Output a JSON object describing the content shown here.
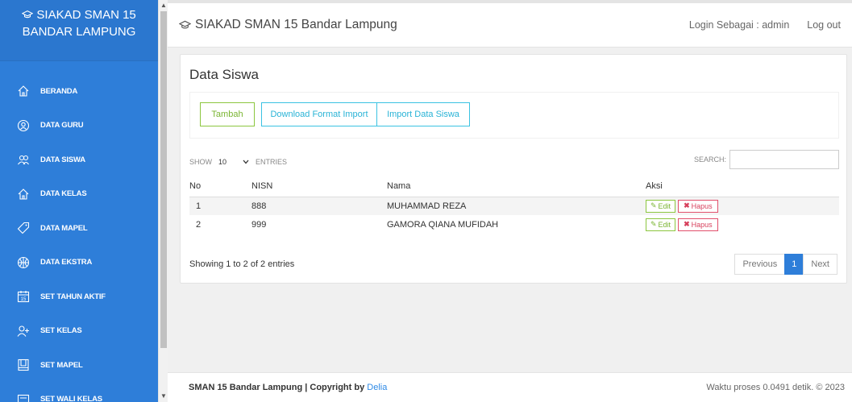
{
  "brand": {
    "line1": "SIAKAD SMAN 15",
    "line2": "BANDAR LAMPUNG"
  },
  "sidebar": {
    "items": [
      {
        "label": "BERANDA",
        "icon": "home-icon"
      },
      {
        "label": "DATA GURU",
        "icon": "user-icon"
      },
      {
        "label": "DATA SISWA",
        "icon": "users-icon"
      },
      {
        "label": "DATA KELAS",
        "icon": "home-icon"
      },
      {
        "label": "DATA MAPEL",
        "icon": "tag-icon"
      },
      {
        "label": "DATA EKSTRA",
        "icon": "globe-icon"
      },
      {
        "label": "SET TAHUN AKTIF",
        "icon": "calendar-icon"
      },
      {
        "label": "SET KELAS",
        "icon": "user-add-icon"
      },
      {
        "label": "SET MAPEL",
        "icon": "book-icon"
      },
      {
        "label": "SET WALI KELAS",
        "icon": "board-icon"
      }
    ]
  },
  "header": {
    "title": "SIAKAD SMAN 15 Bandar Lampung",
    "login_as": "Login Sebagai : admin",
    "logout": "Log out"
  },
  "main": {
    "title": "Data Siswa",
    "buttons": {
      "add": "Tambah",
      "download": "Download Format Import",
      "import": "Import Data Siswa"
    },
    "show_label": "SHOW",
    "page_length": "10",
    "entries_label": "ENTRIES",
    "search_label": "SEARCH:",
    "search_value": "",
    "table": {
      "columns": [
        "No",
        "NISN",
        "Nama",
        "Aksi"
      ],
      "rows": [
        {
          "no": "1",
          "nisn": "888",
          "nama": "MUHAMMAD REZA"
        },
        {
          "no": "2",
          "nisn": "999",
          "nama": "GAMORA QIANA MUFIDAH"
        }
      ],
      "edit_label": "Edit",
      "delete_label": "Hapus"
    },
    "info": "Showing 1 to 2 of 2 entries",
    "pagination": {
      "previous": "Previous",
      "current": "1",
      "next": "Next"
    }
  },
  "footer": {
    "text": "SMAN 15 Bandar Lampung | Copyright by ",
    "author": "Delia",
    "process": "Waktu proses 0.0491 detik. © 2023"
  },
  "colors": {
    "sidebar": "#2e7ed9",
    "accent_green": "#8cc63f",
    "accent_cyan": "#3bc2e2",
    "accent_red": "#e2506c"
  }
}
